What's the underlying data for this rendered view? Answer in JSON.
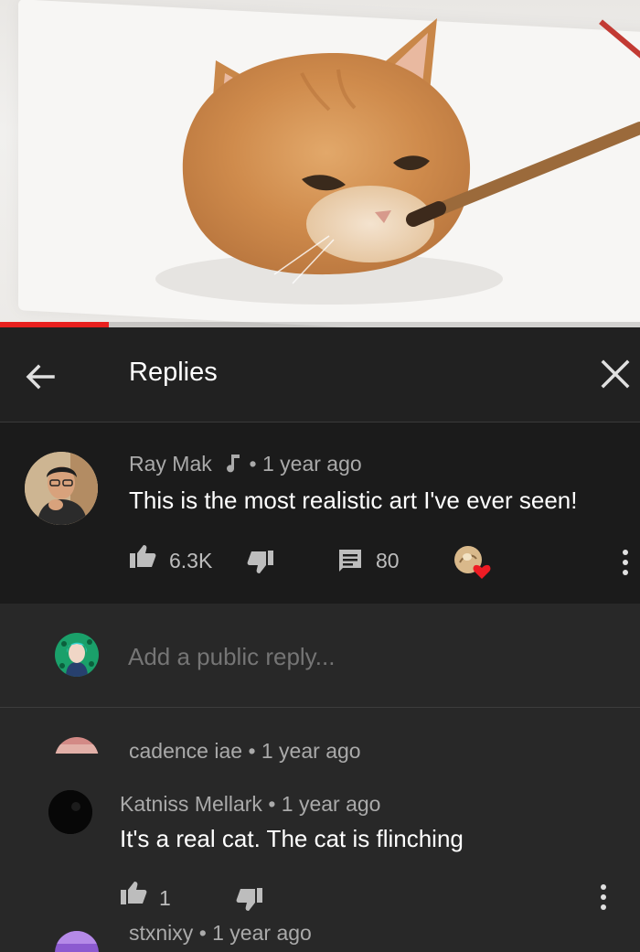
{
  "video": {
    "progress_fraction": 0.17,
    "progress_color": "#e8201e"
  },
  "header": {
    "title": "Replies",
    "back_icon": "arrow-left-icon",
    "close_icon": "close-icon"
  },
  "main_comment": {
    "author": "Ray Mak",
    "badge_icon": "music-note-icon",
    "time": "• 1 year ago",
    "text": "This is the most realistic art I've ever seen!",
    "likes": "6.3K",
    "replies": "80",
    "creator_heart_icon": "creator-heart-icon"
  },
  "reply_input": {
    "placeholder": "Add a public reply..."
  },
  "replies": [
    {
      "author": "cadence iae",
      "time": "• 1 year ago"
    },
    {
      "author": "Katniss Mellark",
      "time": "• 1 year ago",
      "text": "It's a real cat. The cat is flinching",
      "likes": "1"
    },
    {
      "author": "stxnixy",
      "time": "• 1 year ago"
    }
  ]
}
